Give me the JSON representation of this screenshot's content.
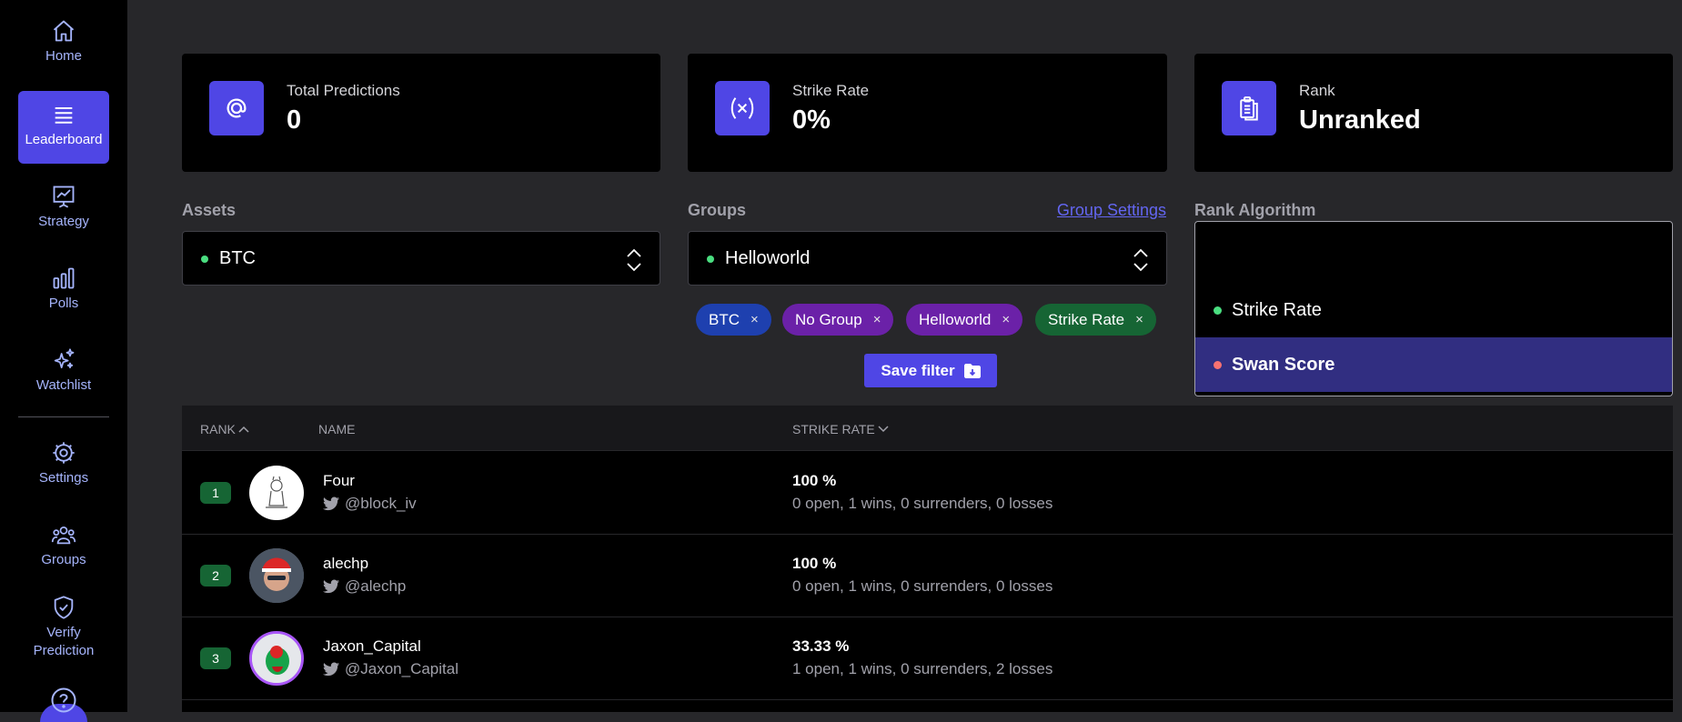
{
  "sidebar": {
    "items": [
      {
        "label": "Home",
        "icon": "home-icon"
      },
      {
        "label": "Leaderboard",
        "icon": "menu-icon",
        "active": true
      },
      {
        "label": "Strategy",
        "icon": "presentation-chart-icon"
      },
      {
        "label": "Polls",
        "icon": "bar-chart-icon"
      },
      {
        "label": "Watchlist",
        "icon": "sparkles-icon"
      },
      {
        "label": "Settings",
        "icon": "gear-icon"
      },
      {
        "label": "Groups",
        "icon": "users-icon"
      },
      {
        "label": "Verify Prediction",
        "icon": "shield-check-icon"
      }
    ]
  },
  "stats": {
    "total_predictions": {
      "label": "Total Predictions",
      "value": "0",
      "icon": "at-icon"
    },
    "strike_rate": {
      "label": "Strike Rate",
      "value": "0%",
      "icon": "variable-icon"
    },
    "rank": {
      "label": "Rank",
      "value": "Unranked",
      "icon": "clipboard-icon"
    }
  },
  "filters": {
    "assets_label": "Assets",
    "assets_value": "BTC",
    "groups_label": "Groups",
    "group_settings_link": "Group Settings",
    "groups_value": "Helloworld",
    "algo_label": "Rank Algorithm",
    "algo_options": [
      {
        "label": "Strike Rate",
        "color": "#4ade80",
        "selected": false
      },
      {
        "label": "Swan Score",
        "color": "#f87171",
        "selected": true
      }
    ],
    "chips": [
      {
        "label": "BTC",
        "color": "#1e40af"
      },
      {
        "label": "No Group",
        "color": "#6b21a8"
      },
      {
        "label": "Helloworld",
        "color": "#6b21a8"
      },
      {
        "label": "Strike Rate",
        "color": "#166534"
      }
    ],
    "chip_remove_glyph": "×",
    "save_label": "Save filter"
  },
  "table": {
    "headers": {
      "rank": "RANK",
      "name": "NAME",
      "strike_rate": "STRIKE RATE"
    },
    "rows": [
      {
        "rank": "1",
        "name": "Four",
        "handle": "@block_iv",
        "rate": "100 %",
        "stats": "0 open, 1 wins, 0 surrenders, 0 losses"
      },
      {
        "rank": "2",
        "name": "alechp",
        "handle": "@alechp",
        "rate": "100 %",
        "stats": "0 open, 1 wins, 0 surrenders, 0 losses"
      },
      {
        "rank": "3",
        "name": "Jaxon_Capital",
        "handle": "@Jaxon_Capital",
        "rate": "33.33 %",
        "stats": "1 open, 1 wins, 0 surrenders, 2 losses"
      }
    ]
  }
}
